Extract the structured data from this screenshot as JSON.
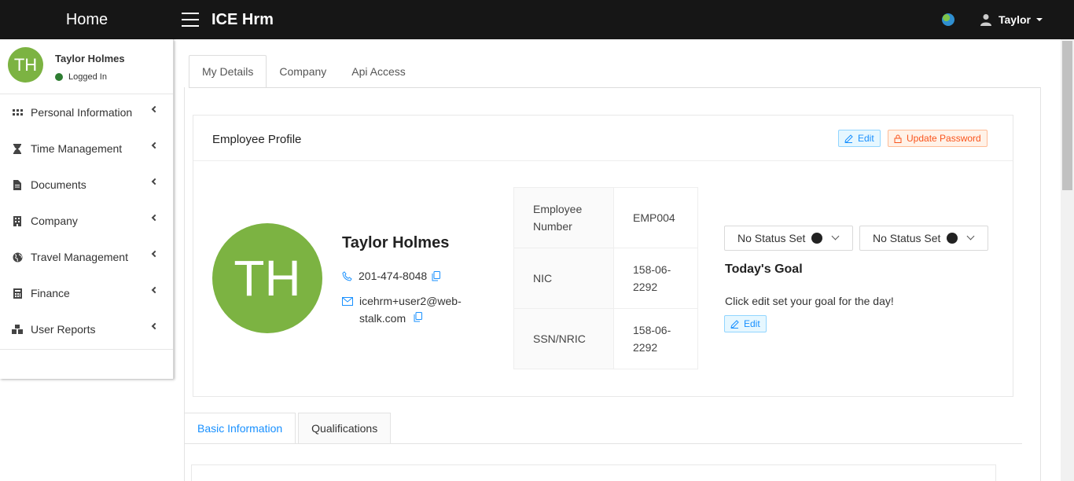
{
  "topbar": {
    "brand": "Home",
    "app_title": "ICE Hrm",
    "user_label": "Taylor"
  },
  "sidebar": {
    "user": {
      "initials": "TH",
      "name": "Taylor Holmes",
      "status": "Logged In"
    },
    "items": [
      {
        "label": "Personal Information",
        "icon": "grid-icon"
      },
      {
        "label": "Time Management",
        "icon": "hourglass-icon"
      },
      {
        "label": "Documents",
        "icon": "document-icon"
      },
      {
        "label": "Company",
        "icon": "building-icon"
      },
      {
        "label": "Travel Management",
        "icon": "globe-icon"
      },
      {
        "label": "Finance",
        "icon": "calculator-icon"
      },
      {
        "label": "User Reports",
        "icon": "cubes-icon"
      }
    ]
  },
  "top_tabs": [
    "My Details",
    "Company",
    "Api Access"
  ],
  "profile": {
    "header_title": "Employee Profile",
    "edit_label": "Edit",
    "update_password_label": "Update Password",
    "initials": "TH",
    "name": "Taylor Holmes",
    "phone": "201-474-8048",
    "email": "icehrm+user2@web-stalk.com",
    "ids": [
      {
        "label": "Employee Number",
        "value": "EMP004"
      },
      {
        "label": "NIC",
        "value": "158-06-2292"
      },
      {
        "label": "SSN/NRIC",
        "value": "158-06-2292"
      }
    ],
    "status_1": "No Status Set",
    "status_2": "No Status Set",
    "goal_title": "Today's Goal",
    "goal_text": "Click edit set your goal for the day!",
    "goal_edit_label": "Edit"
  },
  "bottom_tabs": [
    "Basic Information",
    "Qualifications"
  ],
  "colors": {
    "topbar": "#161616",
    "avatar": "#7cb342",
    "accent": "#1890ff",
    "danger": "#fa541c",
    "online": "#2e7d32"
  }
}
